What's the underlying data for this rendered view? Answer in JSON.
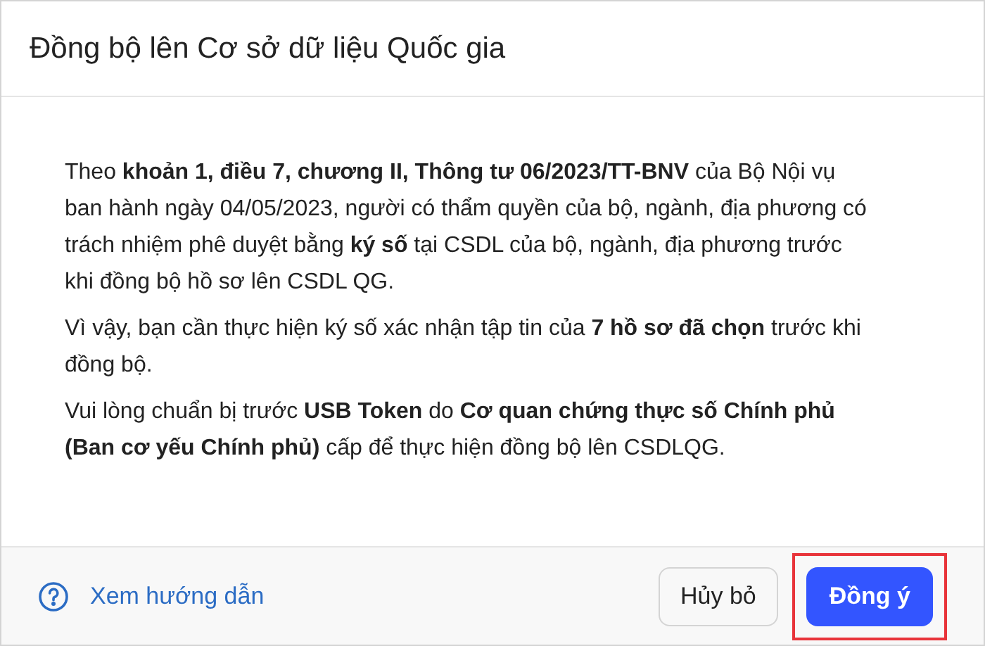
{
  "dialog": {
    "title": "Đồng bộ lên Cơ sở dữ liệu Quốc gia",
    "paragraphs": [
      "Theo **khoản 1, điều 7, chương II, Thông tư 06/2023/TT-BNV** của Bộ Nội vụ ban hành ngày 04/05/2023, người có thẩm quyền của bộ, ngành, địa phương có trách nhiệm phê duyệt bằng **ký số** tại CSDL của bộ, ngành, địa phương trước khi đồng bộ hồ sơ lên CSDL QG.",
      "Vì vậy, bạn cần thực hiện ký số xác nhận tập tin của **7 hồ sơ đã chọn** trước khi đồng bộ.",
      "Vui lòng chuẩn bị trước **USB Token** do **Cơ quan chứng thực số Chính phủ (Ban cơ yếu Chính phủ)** cấp để thực hiện đồng bộ lên CSDLQG."
    ],
    "help_link": "Xem hướng dẫn",
    "buttons": [
      {
        "label": "Hủy bỏ",
        "kind": "secondary",
        "highlighted": false
      },
      {
        "label": "Đồng ý",
        "kind": "primary",
        "highlighted": true
      }
    ]
  }
}
